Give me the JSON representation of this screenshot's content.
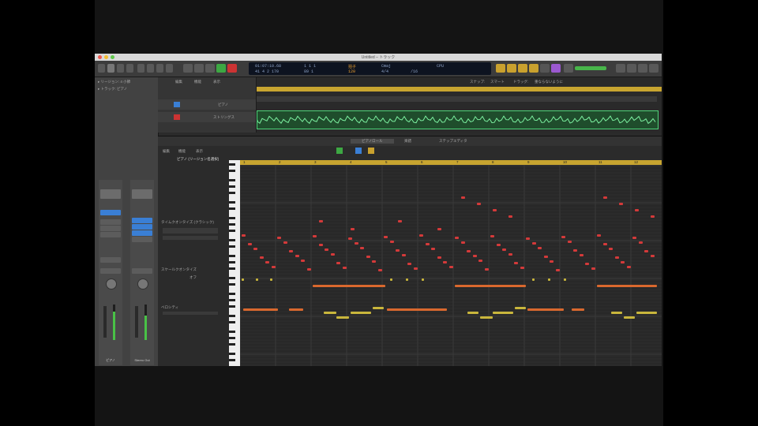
{
  "window": {
    "title": "Untitled – トラック"
  },
  "toolbar": {
    "lcd": {
      "position": "01:07:10.68",
      "bars": "41 4 2 170",
      "beat_a": "1  1  1",
      "beat_b": "89  1",
      "tempo": "120",
      "tempo_label": "拍子",
      "key": "Cmaj",
      "signature": "4/4",
      "division": "/16",
      "cpu": "CPU"
    }
  },
  "inspector": {
    "region_label": "▸ リージョン: 4 小節",
    "track_label": "▸ トラック: ピアノ",
    "strips": [
      {
        "name": "ピアノ",
        "level": 0.8
      },
      {
        "name": "Stereo Out",
        "level": 0.7
      }
    ]
  },
  "tracks": {
    "header_tabs": [
      "編集",
      "機能",
      "表示"
    ],
    "items": [
      {
        "name": "ピアノ",
        "color": "#6ab04c"
      },
      {
        "name": "ストリングス",
        "color": "#6ab04c"
      }
    ],
    "toolbar_labels": [
      "スナップ:",
      "スマート",
      "ドラッグ:",
      "重ならないように"
    ]
  },
  "editor": {
    "tabs": [
      "ピアノロール",
      "楽譜",
      "ステップエディタ"
    ],
    "menu": [
      "編集",
      "機能",
      "表示"
    ],
    "region_name": "ピアノ (リージョン名選択)",
    "param_labels": [
      "ベロシティ",
      "タイムクオンタイズ (クラシック)",
      "スケールクオンタイズ",
      "オフ",
      "ベロシティ"
    ],
    "ruler": [
      "1",
      "2",
      "3",
      "4",
      "5",
      "6",
      "7",
      "8",
      "9",
      "10",
      "11",
      "12"
    ],
    "colors": {
      "red": "#d43a3a",
      "orange": "#d9682e",
      "yellow": "#c9b63c",
      "ruler": "#c8a530",
      "green": "#4fd47a"
    }
  }
}
